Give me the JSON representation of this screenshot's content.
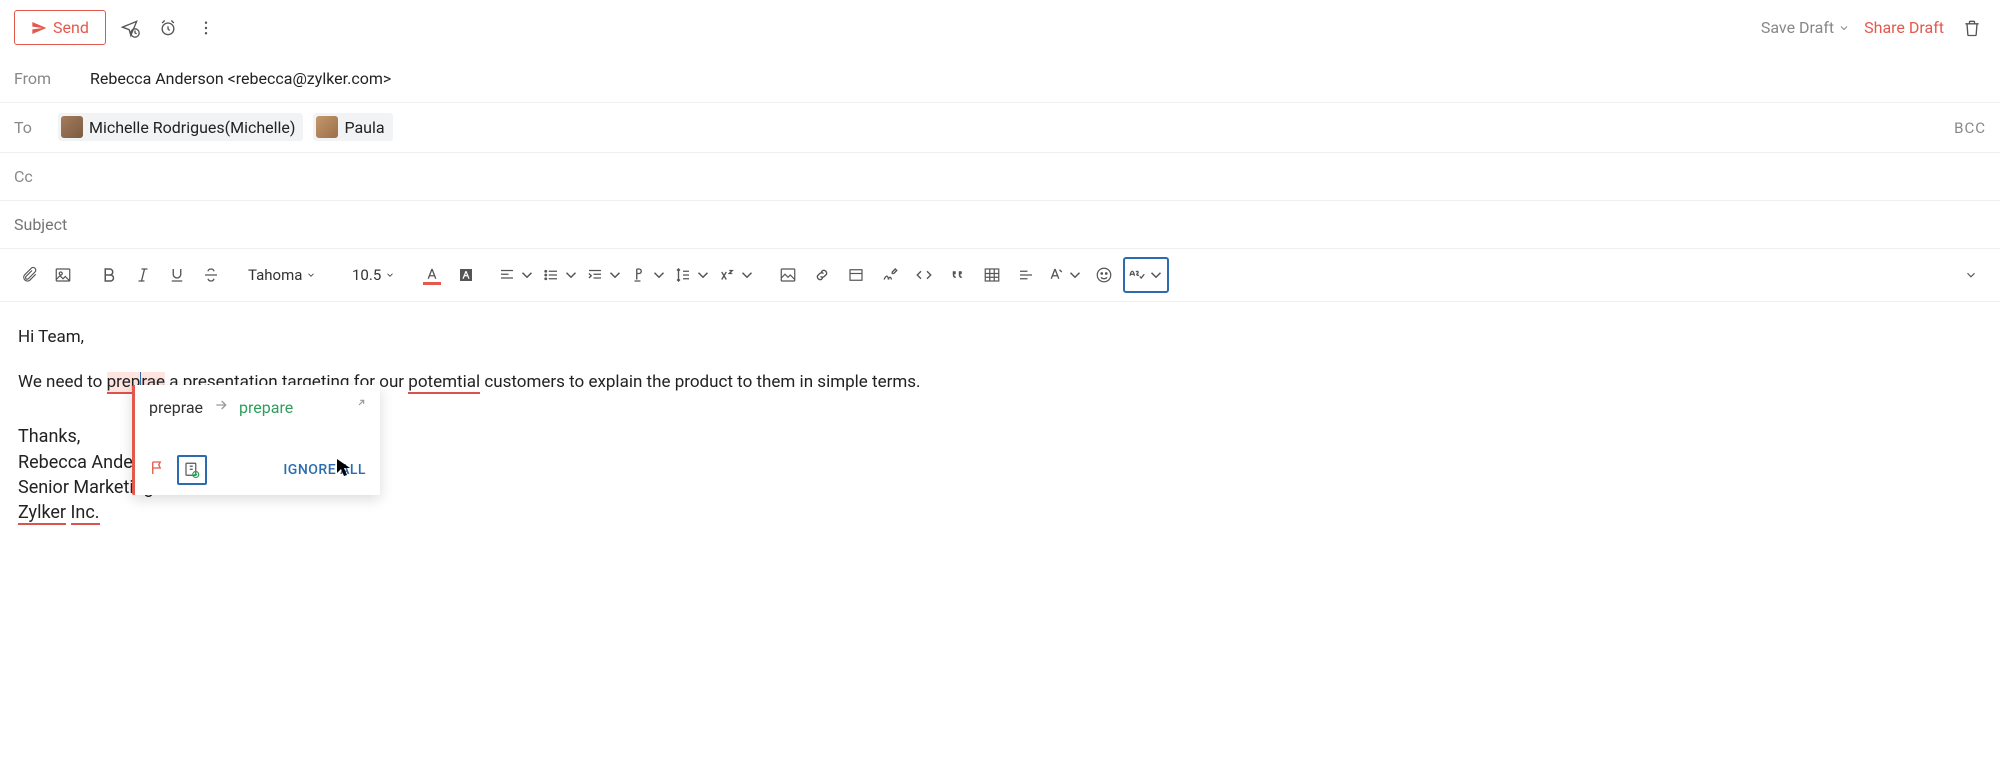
{
  "topbar": {
    "send_label": "Send",
    "save_draft_label": "Save Draft",
    "share_draft_label": "Share Draft"
  },
  "fields": {
    "from_label": "From",
    "from_value": "Rebecca Anderson <rebecca@zylker.com>",
    "to_label": "To",
    "recipients": [
      {
        "name": "Michelle Rodrigues(Michelle)"
      },
      {
        "name": "Paula"
      }
    ],
    "cc_label": "Cc",
    "bcc_label": "BCC",
    "subject_placeholder": "Subject"
  },
  "format": {
    "font_name": "Tahoma",
    "font_size": "10.5"
  },
  "body": {
    "greeting": "Hi Team,",
    "line_pre": "We need to ",
    "err1": "preprae",
    "line_mid": " a presentation targeting for our ",
    "err2": "potemtial",
    "line_post": " customers to explain the product to them in simple terms.",
    "sig_thanks": "Thanks,",
    "sig_name": "Rebecca Anderson,",
    "sig_title": "Senior Marketing Associate",
    "sig_company_a": "Zylker",
    "sig_company_b": "Inc."
  },
  "popup": {
    "from_word": "preprae",
    "to_word": "prepare",
    "ignore_label": "IGNORE ALL"
  }
}
